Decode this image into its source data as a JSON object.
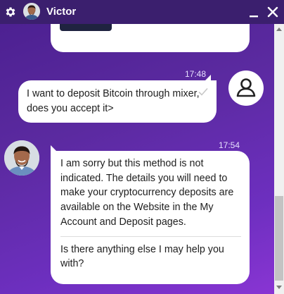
{
  "header": {
    "agent_name": "Victor"
  },
  "messages": [
    {
      "sender": "user",
      "time": "17:48",
      "text": "I want to deposit Bitcoin through mixer, does you accept it>"
    },
    {
      "sender": "agent",
      "time": "17:54",
      "paragraphs": [
        "I am sorry but this method is not indicated. The details you will need to make your cryptocurrency deposits are available on the Website in the My Account and Deposit pages.",
        "Is there anything else I may help you with?"
      ]
    }
  ],
  "icons": {
    "settings": "gear-icon",
    "minimize": "minimize-icon",
    "close": "close-icon",
    "user_avatar": "user-icon",
    "read_receipt": "check-icon"
  },
  "colors": {
    "header": "#3b1f6e",
    "background_start": "#4a1f8f",
    "background_end": "#8a35d4",
    "bubble": "#ffffff"
  }
}
